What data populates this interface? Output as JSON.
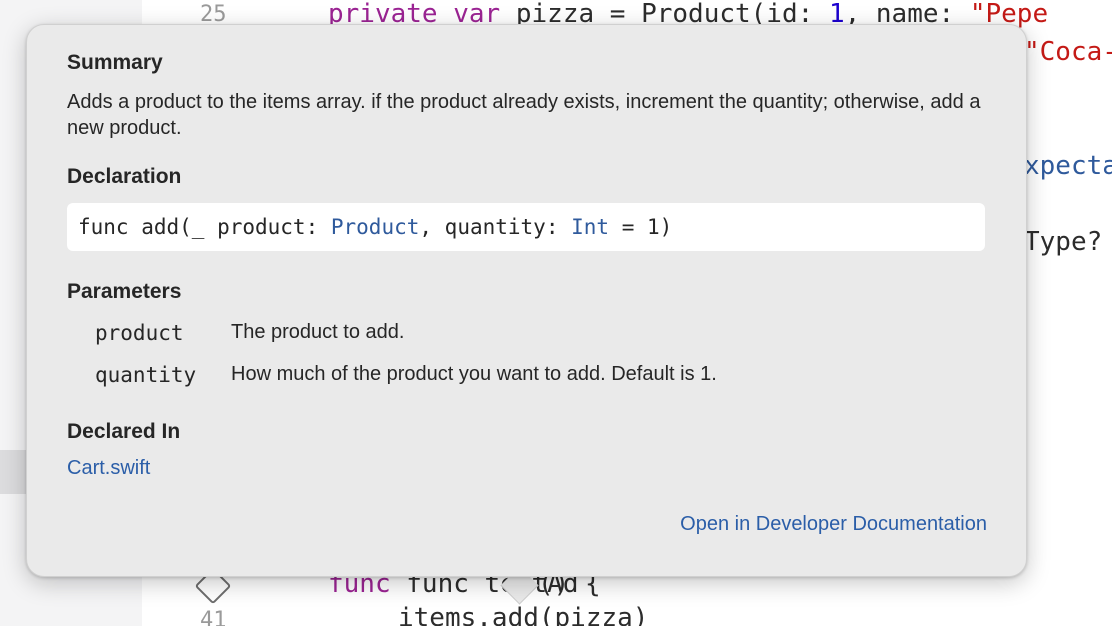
{
  "editor": {
    "line_top": {
      "number": "25",
      "code": [
        {
          "t": "private var pizza = Product(id: 1, name: \"Pepe",
          "k": ""
        }
      ]
    },
    "line_top2_tail": "\"Coca-",
    "line_expect_tail": "xpecta",
    "line_type_tail": "Type?",
    "line_func": "func testAd",
    "line_func_tail": "() {",
    "line_41_number": "41",
    "line_41_code": "items.add(pizza)"
  },
  "popover": {
    "summary": {
      "title": "Summary",
      "text": "Adds a product to the items array. if the product already exists, increment the quantity; otherwise, add a new product."
    },
    "declaration": {
      "title": "Declaration",
      "tokens": [
        {
          "text": "func add(_ product: ",
          "kind": "plain"
        },
        {
          "text": "Product",
          "kind": "type"
        },
        {
          "text": ", quantity: ",
          "kind": "plain"
        },
        {
          "text": "Int",
          "kind": "type"
        },
        {
          "text": " = 1)",
          "kind": "plain"
        }
      ]
    },
    "parameters": {
      "title": "Parameters",
      "items": [
        {
          "name": "product",
          "description": "The product to add."
        },
        {
          "name": "quantity",
          "description": "How much of the product you want to add. Default is 1."
        }
      ]
    },
    "declared_in": {
      "title": "Declared In",
      "file": "Cart.swift"
    },
    "open_docs_link": "Open in Developer Documentation"
  },
  "colors": {
    "link": "#2b5ea8",
    "type_token": "#2f5a9c",
    "popover_bg": "#eaeaea"
  }
}
